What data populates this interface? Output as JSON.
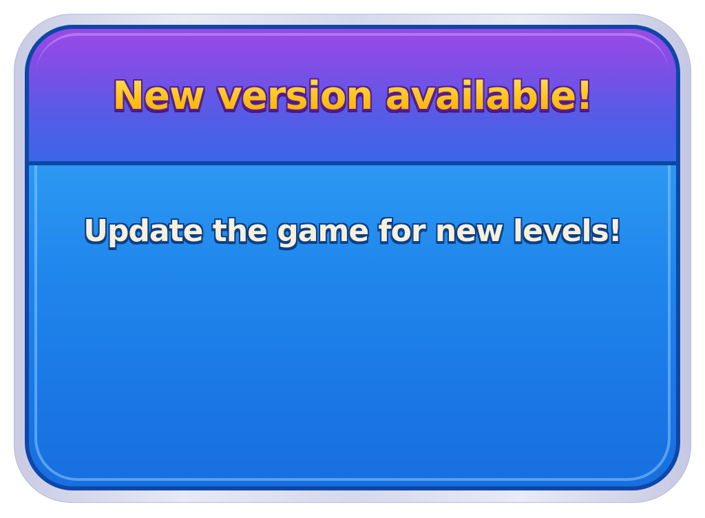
{
  "dialog": {
    "title": "New version available!",
    "message": "Update the game for new levels!"
  },
  "colors": {
    "title_text": "#ffc21a",
    "title_outline": "#5a1f8f",
    "message_text": "#f6f0dc",
    "message_outline": "#0d3f86",
    "header_top": "#9b49e6",
    "header_bottom": "#3a66e8",
    "body_top": "#2c98f2",
    "body_bottom": "#186fe0",
    "border": "#0d47a8",
    "frame": "#d6d8ec"
  }
}
